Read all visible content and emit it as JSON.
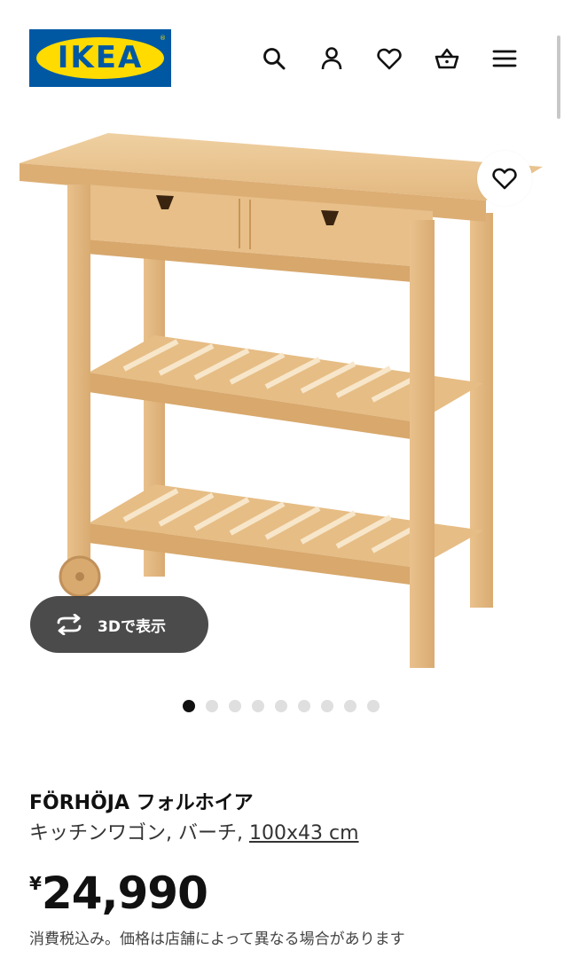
{
  "header": {
    "logo_text": "IKEA",
    "icons": [
      "search-icon",
      "account-icon",
      "favorites-icon",
      "basket-icon",
      "menu-icon"
    ]
  },
  "gallery": {
    "view3d_label": "3Dで表示",
    "dot_count": 9,
    "active_index": 0
  },
  "product": {
    "name": "FÖRHÖJA フォルホイア",
    "type": "キッチンワゴン, バーチ,",
    "size": "100x43 cm",
    "currency": "¥",
    "price": "24,990",
    "tax_note": "消費税込み。価格は店舗によって異なる場合があります"
  },
  "colors": {
    "brand_blue": "#0058a3",
    "brand_yellow": "#ffdb00",
    "wood": "#ecc694"
  }
}
